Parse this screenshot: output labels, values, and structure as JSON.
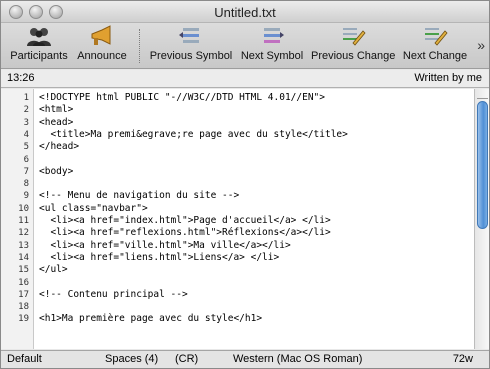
{
  "window": {
    "title": "Untitled.txt"
  },
  "toolbar": {
    "participants": "Participants",
    "announce": "Announce",
    "previous_symbol": "Previous Symbol",
    "next_symbol": "Next Symbol",
    "previous_change": "Previous Change",
    "next_change": "Next Change",
    "overflow": "»"
  },
  "status": {
    "time": "13:26",
    "author": "Written by me"
  },
  "editor": {
    "line_numbers": [
      "1",
      "2",
      "3",
      "4",
      "5",
      "6",
      "7",
      "8",
      "9",
      "10",
      "11",
      "12",
      "13",
      "14",
      "15",
      "16",
      "17",
      "18",
      "19"
    ],
    "lines": [
      "<!DOCTYPE html PUBLIC \"-//W3C//DTD HTML 4.01//EN\">",
      "<html>",
      "<head>",
      "  <title>Ma premi&egrave;re page avec du style</title>",
      "</head>",
      "",
      "<body>",
      "",
      "<!-- Menu de navigation du site -->",
      "<ul class=\"navbar\">",
      "  <li><a href=\"index.html\">Page d'accueil</a> </li>",
      "  <li><a href=\"reflexions.html\">Réflexions</a></li>",
      "  <li><a href=\"ville.html\">Ma ville</a></li>",
      "  <li><a href=\"liens.html\">Liens</a> </li>",
      "</ul>",
      "",
      "<!-- Contenu principal -->",
      "",
      "<h1>Ma première page avec du style</h1>"
    ]
  },
  "bottom": {
    "style": "Default",
    "indent": "Spaces (4)",
    "line_ending": "(CR)",
    "encoding": "Western (Mac OS Roman)",
    "width": "72w"
  }
}
